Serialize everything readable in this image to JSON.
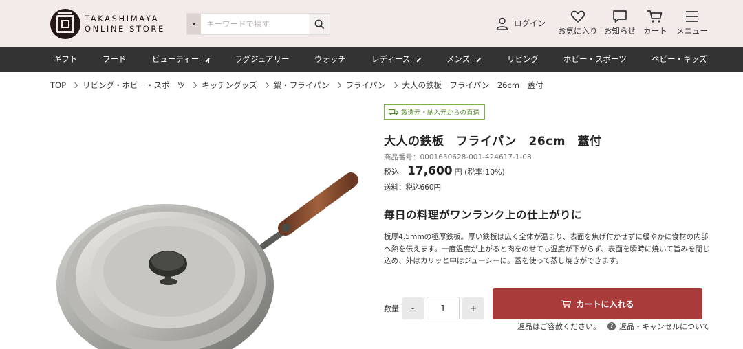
{
  "header": {
    "logo_line1": "TAKASHIMAYA",
    "logo_line2": "ONLINE STORE",
    "search_placeholder": "キーワードで探す",
    "login": "ログイン",
    "favorites": "お気に入り",
    "notifications": "お知らせ",
    "cart": "カート",
    "menu": "メニュー"
  },
  "nav": {
    "items": [
      "ギフト",
      "フード",
      "ビューティー",
      "ラグジュアリー",
      "ウォッチ",
      "レディース",
      "メンズ",
      "リビング",
      "ホビー・スポーツ",
      "ベビー・キッズ"
    ]
  },
  "breadcrumb": [
    "TOP",
    "リビング・ホビー・スポーツ",
    "キッチングッズ",
    "鍋・フライパン",
    "フライパン",
    "大人の鉄板　フライパン　26cm　蓋付"
  ],
  "product": {
    "badge": "製造元・納入元からの直送",
    "title": "大人の鉄板　フライパン　26cm　蓋付",
    "item_number": "商品番号：0001650628-001-424617-1-08",
    "price_label": "税込",
    "price": "17,600",
    "price_unit": "円 (税率:10%)",
    "shipping": "送料：税込660円",
    "headline": "毎日の料理がワンランク上の仕上がりに",
    "description": "板厚4.5mmの極厚鉄板。厚い鉄板は広く全体が温まり、表面を焦げ付かせずに緩やかに食材の内部へ熱を伝えます。一度温度が上がると肉をのせても温度が下がらず、表面を瞬時に焼いて旨みを閉じ込め、外はカリッと中はジューシーに。蓋を使って蒸し焼きができます。"
  },
  "purchase": {
    "quantity_label": "数量",
    "minus": "-",
    "quantity": "1",
    "plus": "+",
    "add_to_cart": "カートに入れる",
    "return_note": "返品はご容赦ください。",
    "return_link": "返品・キャンセルについて"
  },
  "colors": {
    "nav_bg": "#333333",
    "header_bg": "#f2ebe9",
    "cart_button": "#a93c3a",
    "badge_green": "#7cb342"
  }
}
